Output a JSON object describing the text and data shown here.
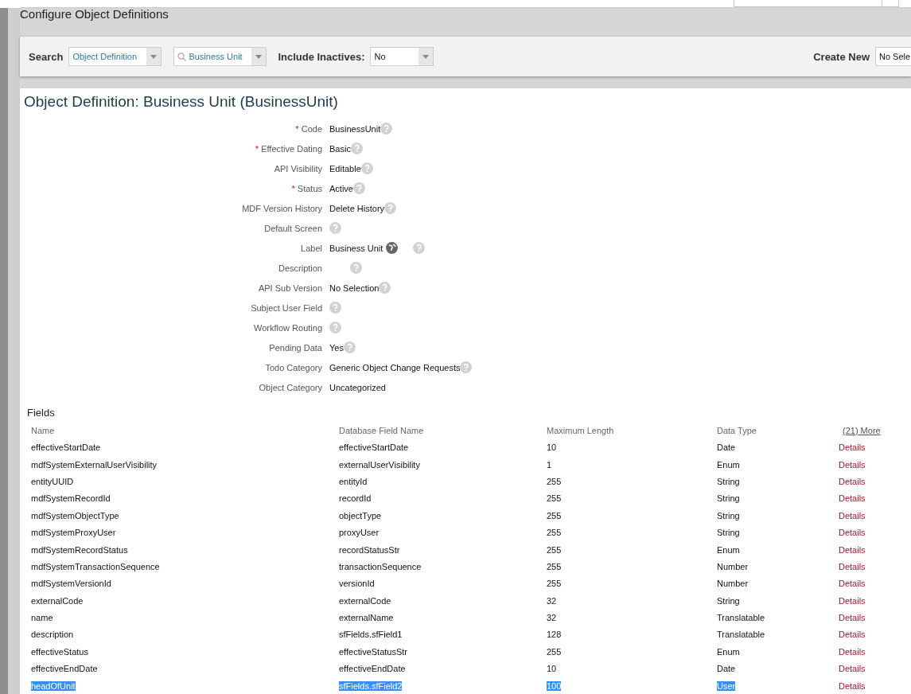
{
  "page_title": "Configure Object Definitions",
  "toolbar": {
    "search_label": "Search",
    "type_select": {
      "value": "Object Definition"
    },
    "object_select": {
      "value": "Business Unit"
    },
    "inactives_label": "Include Inactives:",
    "inactives_select": {
      "value": "No"
    },
    "create_label": "Create New",
    "create_select": {
      "value": "No Sele"
    }
  },
  "object_title": "Object Definition: Business Unit (BusinessUnit)",
  "properties": [
    {
      "label": "Code",
      "value": "BusinessUnit",
      "marker": "*",
      "kind": "plain"
    },
    {
      "label": "Effective Dating",
      "value": "Basic",
      "marker": "*",
      "kind": "plain"
    },
    {
      "label": "API Visibility",
      "value": "Editable",
      "kind": "plain"
    },
    {
      "label": "Status",
      "value": "Active",
      "marker": "*",
      "kind": "plain"
    },
    {
      "label": "MDF Version History",
      "value": "Delete History",
      "kind": "plain"
    },
    {
      "label": "Default Screen",
      "kind": "plain"
    },
    {
      "label": "Label",
      "value": "Business Unit",
      "kind": "translatable"
    },
    {
      "label": "Description",
      "kind": "translatable"
    },
    {
      "label": "API Sub Version",
      "value": "No Selection",
      "kind": "plain"
    },
    {
      "label": "Subject User Field",
      "kind": "plain"
    },
    {
      "label": "Workflow Routing",
      "kind": "plain"
    },
    {
      "label": "Pending Data",
      "value": "Yes",
      "kind": "plain"
    },
    {
      "label": "Todo Category",
      "value": "Generic Object Change Requests",
      "kind": "plain"
    },
    {
      "label": "Object Category",
      "value": "Uncategorized",
      "kind": "nohelp"
    }
  ],
  "fields": {
    "title": "Fields",
    "columns": [
      "Name",
      "Database Field Name",
      "Maximum Length",
      "Data Type"
    ],
    "more_link": "(21) More",
    "rows": [
      {
        "name": "effectiveStartDate",
        "db": "effectiveStartDate",
        "max": "10",
        "type": "Date",
        "action": "Details",
        "highlighted": false
      },
      {
        "name": "mdfSystemExternalUserVisibility",
        "db": "externalUserVisibility",
        "max": "1",
        "type": "Enum",
        "action": "Details",
        "highlighted": false
      },
      {
        "name": "entityUUID",
        "db": "entityId",
        "max": "255",
        "type": "String",
        "action": "Details",
        "highlighted": false
      },
      {
        "name": "mdfSystemRecordId",
        "db": "recordId",
        "max": "255",
        "type": "String",
        "action": "Details",
        "highlighted": false
      },
      {
        "name": "mdfSystemObjectType",
        "db": "objectType",
        "max": "255",
        "type": "String",
        "action": "Details",
        "highlighted": false
      },
      {
        "name": "mdfSystemProxyUser",
        "db": "proxyUser",
        "max": "255",
        "type": "String",
        "action": "Details",
        "highlighted": false
      },
      {
        "name": "mdfSystemRecordStatus",
        "db": "recordStatusStr",
        "max": "255",
        "type": "Enum",
        "action": "Details",
        "highlighted": false
      },
      {
        "name": "mdfSystemTransactionSequence",
        "db": "transactionSequence",
        "max": "255",
        "type": "Number",
        "action": "Details",
        "highlighted": false
      },
      {
        "name": "mdfSystemVersionId",
        "db": "versionId",
        "max": "255",
        "type": "Number",
        "action": "Details",
        "highlighted": false
      },
      {
        "name": "externalCode",
        "db": "externalCode",
        "max": "32",
        "type": "String",
        "action": "Details",
        "highlighted": false
      },
      {
        "name": "name",
        "db": "externalName",
        "max": "32",
        "type": "Translatable",
        "action": "Details",
        "highlighted": false
      },
      {
        "name": "description",
        "db": "sfFields.sfField1",
        "max": "128",
        "type": "Translatable",
        "action": "Details",
        "highlighted": false
      },
      {
        "name": "effectiveStatus",
        "db": "effectiveStatusStr",
        "max": "255",
        "type": "Enum",
        "action": "Details",
        "highlighted": false
      },
      {
        "name": "effectiveEndDate",
        "db": "effectiveEndDate",
        "max": "10",
        "type": "Date",
        "action": "Details",
        "highlighted": false
      },
      {
        "name": "headOfUnit",
        "db": "sfFields.sfField2",
        "max": "100",
        "type": "User",
        "action": "Details",
        "highlighted": true
      }
    ]
  }
}
